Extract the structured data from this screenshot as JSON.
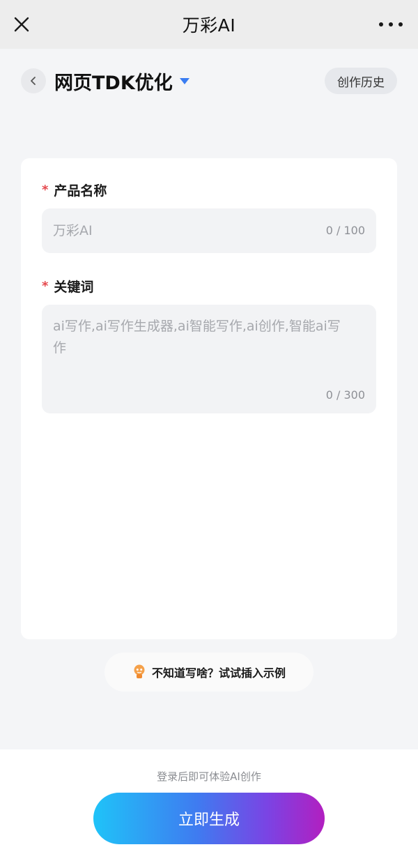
{
  "app": {
    "title": "万彩AI"
  },
  "header": {
    "page_title": "网页TDK优化",
    "history_label": "创作历史"
  },
  "form": {
    "product": {
      "label": "产品名称",
      "placeholder": "万彩AI",
      "counter": "0 / 100"
    },
    "keywords": {
      "label": "关键词",
      "placeholder_line1": "ai写作,ai写作生成器,ai智能写作,ai创作,智能ai写",
      "placeholder_line2": "作",
      "counter": "0 / 300"
    },
    "required_mark": "*"
  },
  "tip": {
    "text": "不知道写啥？试试插入示例"
  },
  "footer": {
    "login_hint": "登录后即可体验AI创作",
    "generate_label": "立即生成"
  },
  "colors": {
    "accent": "#3a7df2",
    "required": "#e5484d"
  }
}
